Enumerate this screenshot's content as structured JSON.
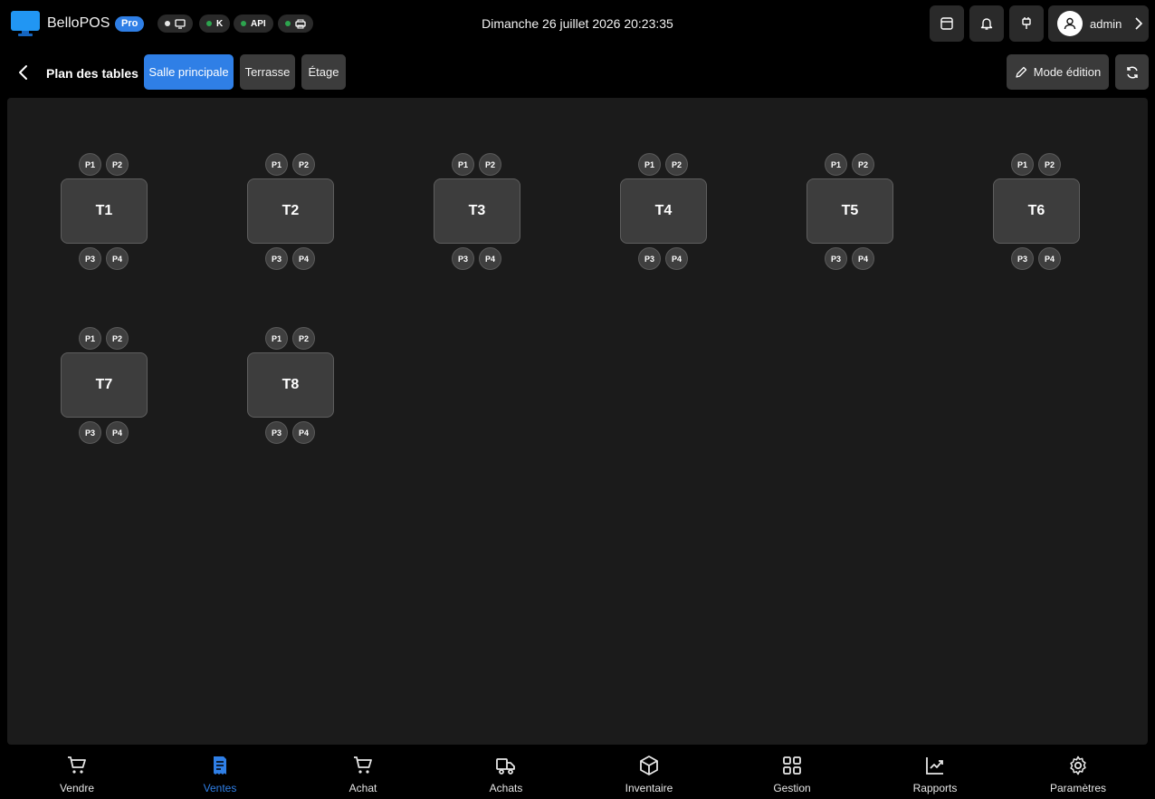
{
  "app": {
    "name": "BelloPOS",
    "badge": "Pro"
  },
  "status": [
    {
      "label": "",
      "dot": "#e6e6e6",
      "icon": "monitor-icon"
    },
    {
      "label": "K",
      "dot": "#2da44e",
      "icon": ""
    },
    {
      "label": "API",
      "dot": "#2da44e",
      "icon": ""
    },
    {
      "label": "",
      "dot": "#2da44e",
      "icon": "printer-icon"
    }
  ],
  "datetime": "Dimanche 26 juillet 2026  20:23:35",
  "user": {
    "name": "admin"
  },
  "header_icons": [
    "cash-drawer-icon",
    "bell-icon",
    "plug-icon"
  ],
  "page": {
    "title": "Plan des tables"
  },
  "tabs": [
    {
      "label": "Salle principale",
      "active": true
    },
    {
      "label": "Terrasse",
      "active": false
    },
    {
      "label": "Étage",
      "active": false
    }
  ],
  "edit_mode_label": "Mode édition",
  "seat_labels": [
    "P1",
    "P2",
    "P3",
    "P4"
  ],
  "tables": [
    "T1",
    "T2",
    "T3",
    "T4",
    "T5",
    "T6",
    "T7",
    "T8"
  ],
  "nav": [
    {
      "label": "Vendre",
      "icon": "cart-icon",
      "active": false
    },
    {
      "label": "Ventes",
      "icon": "receipt-icon",
      "active": true
    },
    {
      "label": "Achat",
      "icon": "cart-icon",
      "active": false
    },
    {
      "label": "Achats",
      "icon": "truck-icon",
      "active": false
    },
    {
      "label": "Inventaire",
      "icon": "box-icon",
      "active": false
    },
    {
      "label": "Gestion",
      "icon": "grid-icon",
      "active": false
    },
    {
      "label": "Rapports",
      "icon": "trend-chart-icon",
      "active": false
    },
    {
      "label": "Paramètres",
      "icon": "gear-icon",
      "active": false
    }
  ],
  "colors": {
    "accent": "#2f7fe6",
    "online": "#2da44e",
    "background": "#000000",
    "floor": "#1b1b1b"
  }
}
